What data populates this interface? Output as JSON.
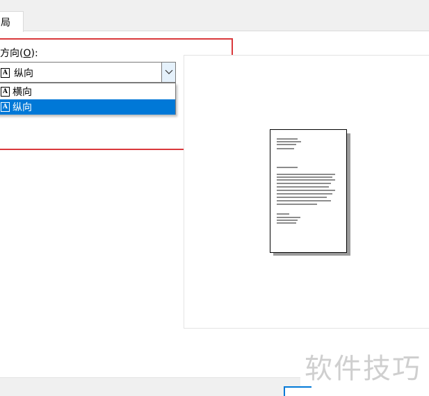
{
  "tab": {
    "label": "局"
  },
  "orientation": {
    "label_prefix": "方向(",
    "label_access": "O",
    "label_suffix": "):",
    "selected": "纵向",
    "options": [
      "横向",
      "纵向"
    ]
  },
  "watermark": {
    "text": "软件技巧"
  },
  "colors": {
    "highlight": "#d9383b",
    "selection": "#0078d7"
  },
  "icons": {
    "orientation_icon": "page-letter-a-icon",
    "dropdown_arrow": "chevron-down-icon"
  }
}
